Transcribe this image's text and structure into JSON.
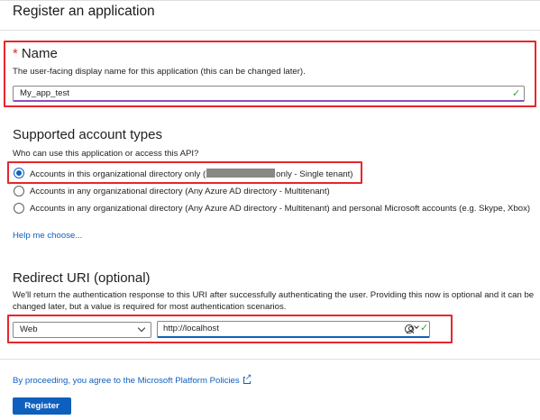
{
  "page": {
    "title": "Register an application"
  },
  "name_section": {
    "heading_star": "*",
    "heading": "Name",
    "description": "The user-facing display name for this application (this can be changed later).",
    "input_value": "My_app_test",
    "check_icon": "checkmark-icon"
  },
  "account_types": {
    "heading": "Supported account types",
    "question": "Who can use this application or access this API?",
    "options": [
      {
        "label_prefix": "Accounts in this organizational directory only (",
        "label_suffix": "only - Single tenant)",
        "selected": true
      },
      {
        "label": "Accounts in any organizational directory (Any Azure AD directory - Multitenant)",
        "selected": false
      },
      {
        "label": "Accounts in any organizational directory (Any Azure AD directory - Multitenant) and personal Microsoft accounts (e.g. Skype, Xbox)",
        "selected": false
      }
    ],
    "help_link": "Help me choose..."
  },
  "redirect": {
    "heading": "Redirect URI (optional)",
    "description_line1": "We'll return the authentication response to this URI after successfully authenticating the user. Providing this now is optional and it can be",
    "description_line2": "changed later, but a value is required for most authentication scenarios.",
    "platform_value": "Web",
    "uri_value": "http://localhost"
  },
  "footer": {
    "policy_text": "By proceeding, you agree to the Microsoft Platform Policies",
    "register_label": "Register"
  },
  "colors": {
    "accent": "#0f5fbf",
    "highlight": "#e8262c",
    "valid": "#3d9c3d"
  }
}
